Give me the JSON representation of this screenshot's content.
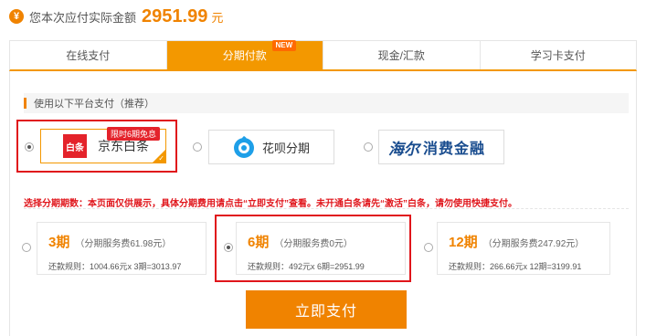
{
  "summary": {
    "label": "您本次应付实际金额",
    "amount": "2951.99",
    "unit": "元"
  },
  "tabs": [
    {
      "label": "在线支付",
      "active": false
    },
    {
      "label": "分期付款",
      "active": true,
      "badge": "NEW"
    },
    {
      "label": "现金/汇款",
      "active": false
    },
    {
      "label": "学习卡支付",
      "active": false
    }
  ],
  "platform_section": {
    "title": "使用以下平台支付（推荐）",
    "platforms": [
      {
        "name": "京东白条",
        "logo_text": "白条",
        "promo": "限时6期免息",
        "selected": true
      },
      {
        "name": "花呗分期",
        "selected": false
      },
      {
        "name_part1": "海尔",
        "name_part2": "消费金融",
        "selected": false
      }
    ]
  },
  "notice": {
    "prefix": "选择分期期数：",
    "text": "本页面仅供展示，具体分期费用请点击“立即支付”查看。未开通白条请先“激活”白条，请勿使用快捷支付。"
  },
  "plans": [
    {
      "period": "3期",
      "fee": "（分期服务费61.98元）",
      "rule": "还款规则：1004.66元x 3期=3013.97",
      "selected": false
    },
    {
      "period": "6期",
      "fee": "（分期服务费0元）",
      "rule": "还款规则：492元x 6期=2951.99",
      "selected": true
    },
    {
      "period": "12期",
      "fee": "（分期服务费247.92元）",
      "rule": "还款规则：266.66元x 12期=3199.91",
      "selected": false
    }
  ],
  "pay_button": "立即支付",
  "colors": {
    "accent": "#f08300",
    "highlight": "#e0151b"
  }
}
